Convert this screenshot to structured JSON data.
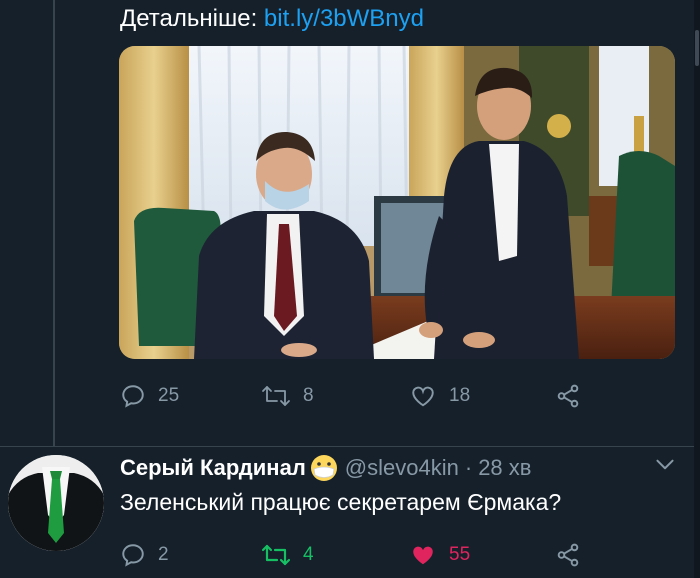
{
  "tweet": {
    "more_label": "Детальніше:",
    "link_text": "bit.ly/3bWBnyd",
    "actions": {
      "reply_count": "25",
      "retweet_count": "8",
      "like_count": "18"
    }
  },
  "reply": {
    "display_name": "Серый Кардинал",
    "handle": "@slevo4kin",
    "separator": "·",
    "time": "28 хв",
    "text": "Зеленський працює секретарем Єрмака?",
    "actions": {
      "reply_count": "2",
      "retweet_count": "4",
      "like_count": "55"
    }
  },
  "colors": {
    "background": "#15202b",
    "link": "#1da1f2",
    "muted": "#8899a6",
    "retweet_active": "#17bf63",
    "like_active": "#e0245e"
  },
  "icons": [
    "reply-icon",
    "retweet-icon",
    "like-icon",
    "share-icon",
    "mask-emoji-icon",
    "chevron-down-icon"
  ]
}
